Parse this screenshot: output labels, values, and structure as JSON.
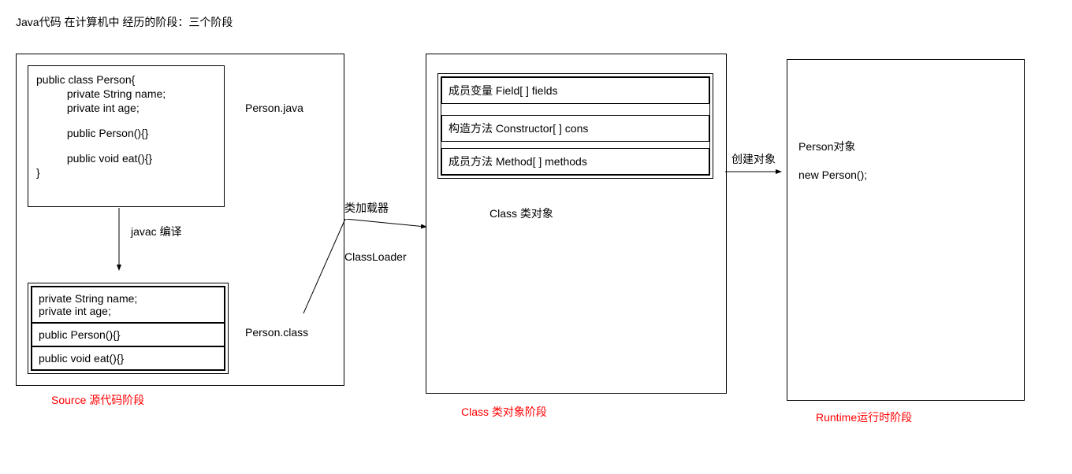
{
  "title": "Java代码 在计算机中 经历的阶段：三个阶段",
  "source": {
    "file_label": "Person.java",
    "code": {
      "l1": "public class Person{",
      "l2": "          private String name;",
      "l3": "          private int age;",
      "l4": "          public Person(){}",
      "l5": "          public void eat(){}",
      "l6": "}"
    },
    "compile_label": "javac 编译",
    "class_file_label": "Person.class",
    "class_file": {
      "c1": "private String name;\nprivate int age;",
      "c2": "public Person(){}",
      "c3": "public void eat(){}"
    },
    "stage_label": "Source 源代码阶段"
  },
  "loader": {
    "top": "类加载器",
    "bottom": "ClassLoader"
  },
  "class_stage": {
    "row1": "成员变量  Field[ ] fields",
    "row2": "构造方法  Constructor[ ] cons",
    "row3": "成员方法 Method[ ] methods",
    "caption": "Class 类对象",
    "stage_label": "Class 类对象阶段"
  },
  "create_label": "创建对象",
  "runtime": {
    "l1": "Person对象",
    "l2": "new Person();",
    "stage_label": "Runtime运行时阶段"
  }
}
